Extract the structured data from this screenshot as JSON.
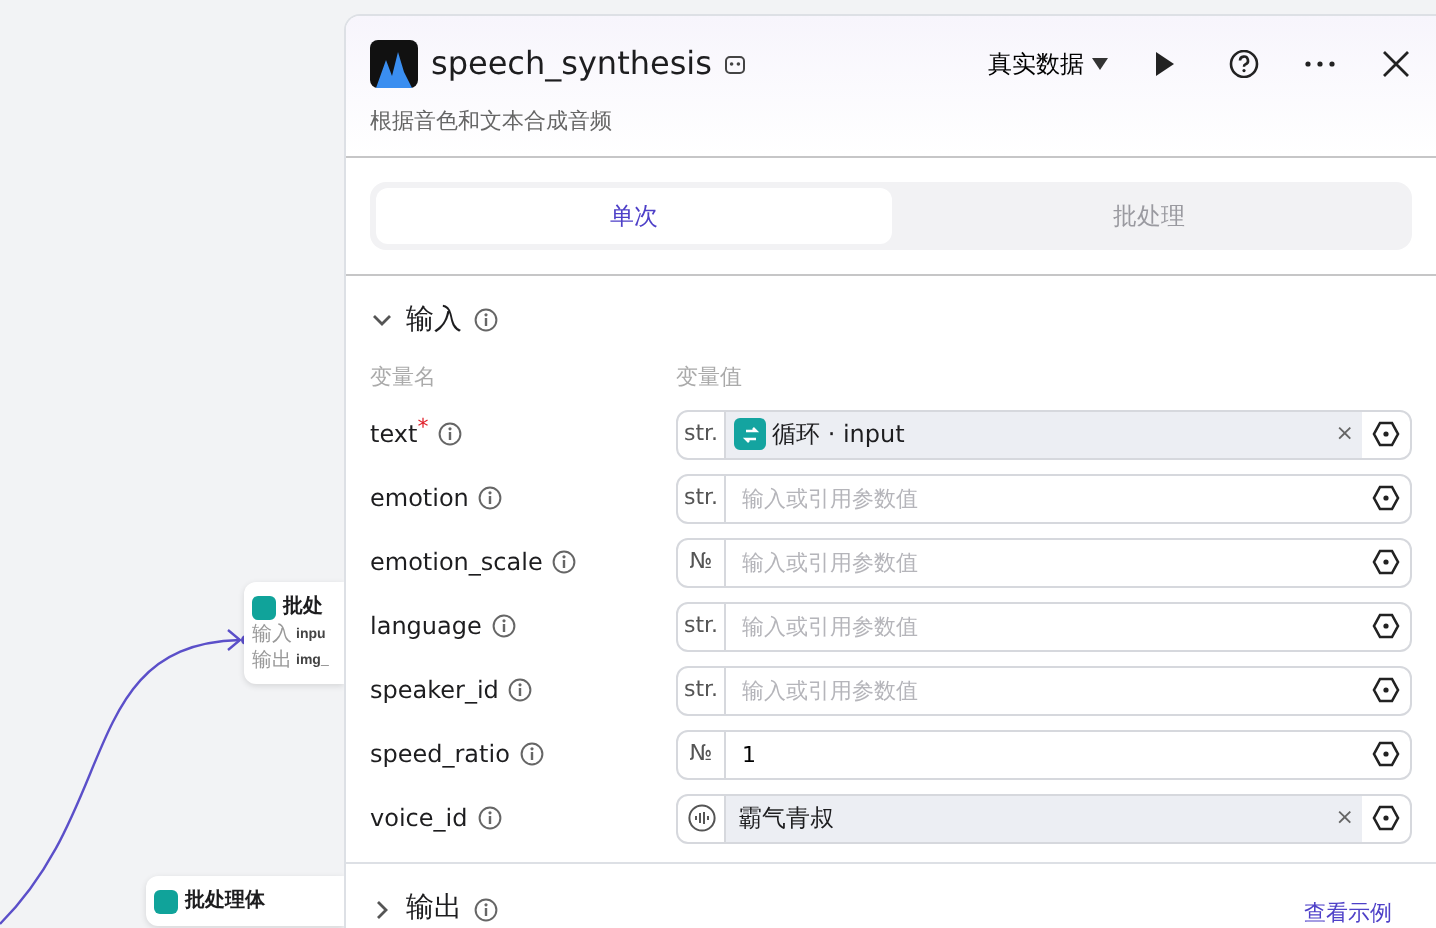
{
  "canvas": {
    "nodes": [
      {
        "title": "批处",
        "rows": [
          {
            "label": "输入",
            "value": "inpu"
          },
          {
            "label": "输出",
            "value": "img_"
          }
        ]
      },
      {
        "title": "批处理体"
      }
    ]
  },
  "panel": {
    "title": "speech_synthesis",
    "subtitle": "根据音色和文本合成音频",
    "data_mode": "真实数据",
    "tabs": [
      {
        "label": "单次",
        "selected": true
      },
      {
        "label": "批处理",
        "selected": false
      }
    ],
    "input_section": {
      "title": "输入",
      "expanded": true,
      "columns": [
        "变量名",
        "变量值"
      ],
      "required_mark": "*",
      "rows": [
        {
          "name": "text",
          "required": true,
          "type": "str.",
          "kind": "reference",
          "value": "循环 · input",
          "clear": "×"
        },
        {
          "name": "emotion",
          "required": false,
          "type": "str.",
          "kind": "input",
          "placeholder": "输入或引用参数值"
        },
        {
          "name": "emotion_scale",
          "required": false,
          "type": "№",
          "kind": "input",
          "placeholder": "输入或引用参数值"
        },
        {
          "name": "language",
          "required": false,
          "type": "str.",
          "kind": "input",
          "placeholder": "输入或引用参数值"
        },
        {
          "name": "speaker_id",
          "required": false,
          "type": "str.",
          "kind": "input",
          "placeholder": "输入或引用参数值"
        },
        {
          "name": "speed_ratio",
          "required": false,
          "type": "№",
          "kind": "input",
          "value": "1"
        },
        {
          "name": "voice_id",
          "required": false,
          "kind": "voice",
          "value": "霸气青叔",
          "clear": "×"
        }
      ]
    },
    "output_section": {
      "title": "输出",
      "expanded": false,
      "link": "查看示例"
    }
  }
}
